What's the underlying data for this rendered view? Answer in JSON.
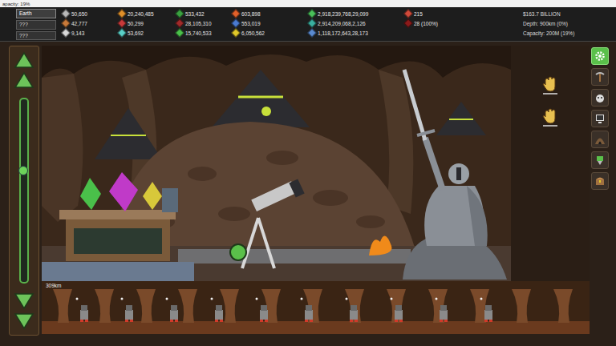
{
  "window": {
    "title": "apacity: 19%"
  },
  "world": {
    "planets": [
      {
        "label": "Earth",
        "selected": true
      },
      {
        "label": "???",
        "selected": false
      },
      {
        "label": "???",
        "selected": false
      }
    ]
  },
  "resources": [
    {
      "items": [
        {
          "value": "50,650",
          "color": "#b8b8b8"
        },
        {
          "value": "42,777",
          "color": "#c87a3a"
        },
        {
          "value": "9,143",
          "color": "#d8d8d8"
        }
      ]
    },
    {
      "items": [
        {
          "value": "20,240,485",
          "color": "#e0902a"
        },
        {
          "value": "50,299",
          "color": "#c83a3a"
        },
        {
          "value": "53,692",
          "color": "#5ad0c8"
        }
      ]
    },
    {
      "items": [
        {
          "value": "533,432",
          "color": "#3aa040"
        },
        {
          "value": "28,105,310",
          "color": "#a02a2a"
        },
        {
          "value": "15,740,533",
          "color": "#4ac04a"
        }
      ]
    },
    {
      "items": [
        {
          "value": "603,898",
          "color": "#e0602a"
        },
        {
          "value": "553,019",
          "color": "#4a7ad0"
        },
        {
          "value": "6,050,562",
          "color": "#e0c82a"
        }
      ]
    },
    {
      "items": [
        {
          "value": "2,918,239,768,29,099",
          "color": "#4ac05a"
        },
        {
          "value": "2,914,209,068,2,126",
          "color": "#3ab0a0"
        },
        {
          "value": "1,118,172,643,28,173",
          "color": "#5a8ad0"
        }
      ]
    },
    {
      "items": [
        {
          "value": "215",
          "color": "#d04a3a"
        },
        {
          "value": "28 (100%)",
          "color": "#8a1a1a"
        }
      ]
    }
  ],
  "stats": [
    "$163.7 BILLION",
    "Depth: 900km (0%)",
    "Capacity: 200M (19%)"
  ],
  "depth_scroller": {
    "level": 0.38
  },
  "strip": {
    "depth": "309km"
  },
  "toolbar": [
    {
      "selected": true
    },
    {
      "selected": false
    },
    {
      "selected": false
    },
    {
      "selected": false
    },
    {
      "selected": false
    },
    {
      "selected": false
    },
    {
      "selected": false
    }
  ]
}
